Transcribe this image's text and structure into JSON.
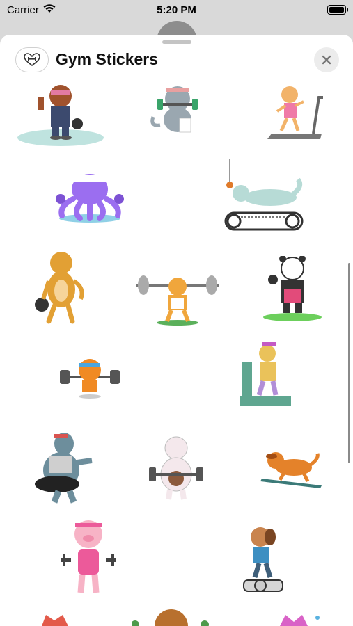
{
  "status_bar": {
    "carrier": "Carrier",
    "time": "5:20 PM"
  },
  "header": {
    "title": "Gym Stickers",
    "app_icon": "heart-dumbbell-icon",
    "close_icon": "close-icon"
  },
  "stickers": [
    {
      "name": "bear-kettlebell"
    },
    {
      "name": "cat-dumbbell"
    },
    {
      "name": "cat-treadmill"
    },
    {
      "name": "octopus-dumbbells"
    },
    {
      "name": "cat-treadmill-spider"
    },
    {
      "name": "cat-kettlebell"
    },
    {
      "name": "cat-barbell"
    },
    {
      "name": "panda-kettlebell"
    },
    {
      "name": "tiger-barbell"
    },
    {
      "name": "cat-stepper"
    },
    {
      "name": "hippo-workout"
    },
    {
      "name": "sheep-kettlebell"
    },
    {
      "name": "dog-treadmill"
    },
    {
      "name": "pig-dumbbells"
    },
    {
      "name": "dog-bike"
    }
  ]
}
